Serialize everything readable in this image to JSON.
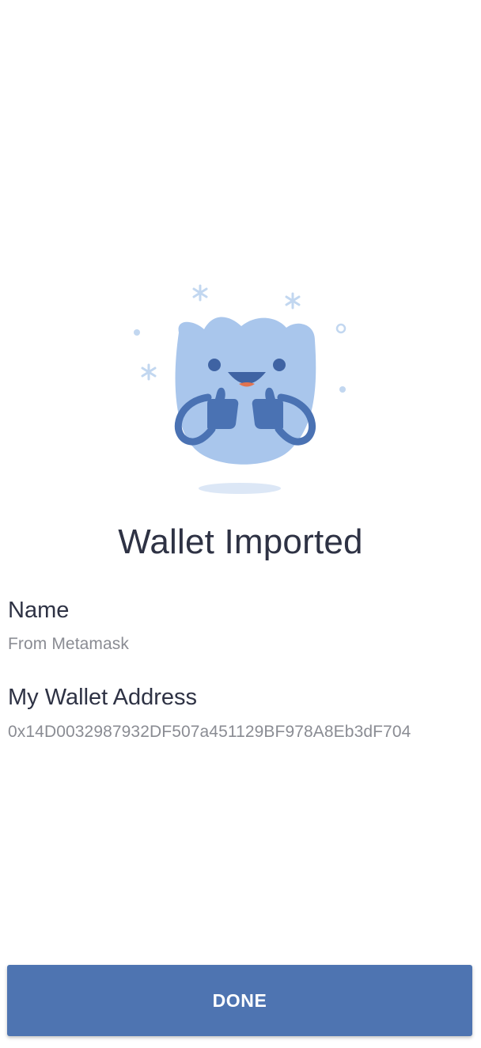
{
  "illustration": {
    "icon": "smiling-wallet-thumbs-up-illustration",
    "colors": {
      "body": "#a9c6ec",
      "arms": "#4a72b3",
      "sparkle": "#c2d7f0",
      "shadow": "#dce7f6",
      "mouth": "#e2734f"
    }
  },
  "title": "Wallet Imported",
  "name": {
    "label": "Name",
    "value": "From Metamask"
  },
  "address": {
    "label": "My Wallet Address",
    "value": "0x14D0032987932DF507a451129BF978A8Eb3dF704"
  },
  "done_button": {
    "label": "DONE",
    "color": "#4e74b1"
  }
}
